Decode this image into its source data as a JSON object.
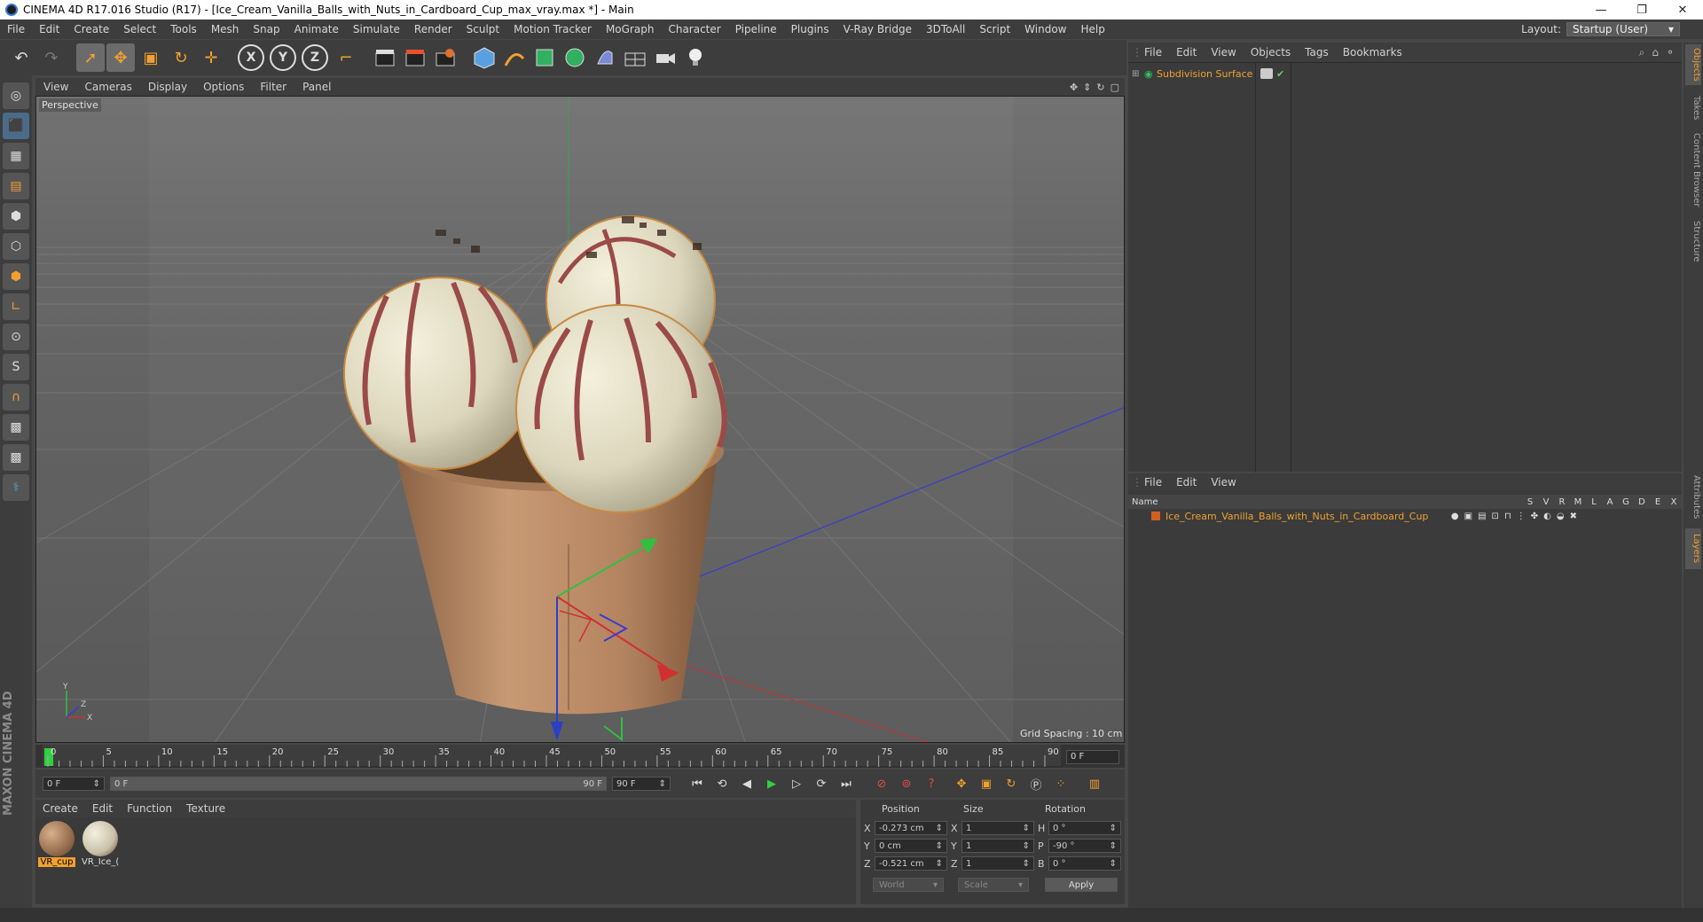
{
  "window": {
    "title": "CINEMA 4D R17.016 Studio (R17) - [Ice_Cream_Vanilla_Balls_with_Nuts_in_Cardboard_Cup_max_vray.max *] - Main",
    "minimize": "—",
    "restore": "❐",
    "close": "✕"
  },
  "menu": {
    "items": [
      "File",
      "Edit",
      "Create",
      "Select",
      "Tools",
      "Mesh",
      "Snap",
      "Animate",
      "Simulate",
      "Render",
      "Sculpt",
      "Motion Tracker",
      "MoGraph",
      "Character",
      "Pipeline",
      "Plugins",
      "V-Ray Bridge",
      "3DToAll",
      "Script",
      "Window",
      "Help"
    ],
    "layout_label": "Layout:",
    "layout_value": "Startup (User)"
  },
  "toolbar": {
    "undo": "↶",
    "redo": "↷",
    "select": "➚",
    "move": "✥",
    "scale": "▣",
    "rotate": "↻",
    "transform": "✛",
    "axis_x": "X",
    "axis_y": "Y",
    "axis_z": "Z",
    "coord": "⌐"
  },
  "viewport": {
    "menu": [
      "View",
      "Cameras",
      "Display",
      "Options",
      "Filter",
      "Panel"
    ],
    "camera_label": "Perspective",
    "grid_spacing": "Grid Spacing : 10 cm",
    "axis_y": "Y",
    "axis_x": "X",
    "axis_z": "Z"
  },
  "timeline": {
    "ticks": [
      "0",
      "5",
      "10",
      "15",
      "20",
      "25",
      "30",
      "35",
      "40",
      "45",
      "50",
      "55",
      "60",
      "65",
      "70",
      "75",
      "80",
      "85",
      "90"
    ],
    "current_frame": "0 F",
    "start_field": "0 F",
    "range_start": "0 F",
    "range_end": "90 F",
    "end_field": "90 F"
  },
  "materials": {
    "menu": [
      "Create",
      "Edit",
      "Function",
      "Texture"
    ],
    "items": [
      {
        "name": "VR_cup",
        "selected": true
      },
      {
        "name": "VR_Ice_(",
        "selected": false
      }
    ]
  },
  "coordinates": {
    "position_label": "Position",
    "size_label": "Size",
    "rotation_label": "Rotation",
    "rows": [
      {
        "axis": "X",
        "pos": "-0.273 cm",
        "size_axis": "X",
        "size": "1",
        "rot_axis": "H",
        "rot": "0 °"
      },
      {
        "axis": "Y",
        "pos": "0 cm",
        "size_axis": "Y",
        "size": "1",
        "rot_axis": "P",
        "rot": "-90 °"
      },
      {
        "axis": "Z",
        "pos": "-0.521 cm",
        "size_axis": "Z",
        "size": "1",
        "rot_axis": "B",
        "rot": "0 °"
      }
    ],
    "world": "World",
    "scale": "Scale",
    "apply": "Apply"
  },
  "object_manager": {
    "menu": [
      "File",
      "Edit",
      "View",
      "Objects",
      "Tags",
      "Bookmarks"
    ],
    "object_name": "Subdivision Surface"
  },
  "layer_manager": {
    "menu": [
      "File",
      "Edit",
      "View"
    ],
    "name_header": "Name",
    "columns": [
      "S",
      "V",
      "R",
      "M",
      "L",
      "A",
      "G",
      "D",
      "E",
      "X"
    ],
    "layer_name": "Ice_Cream_Vanilla_Balls_with_Nuts_in_Cardboard_Cup"
  },
  "right_tabs": [
    "Objects",
    "Takes",
    "Content Browser",
    "Structure",
    "Attributes",
    "Layers"
  ],
  "branding": "MAXON CINEMA 4D"
}
